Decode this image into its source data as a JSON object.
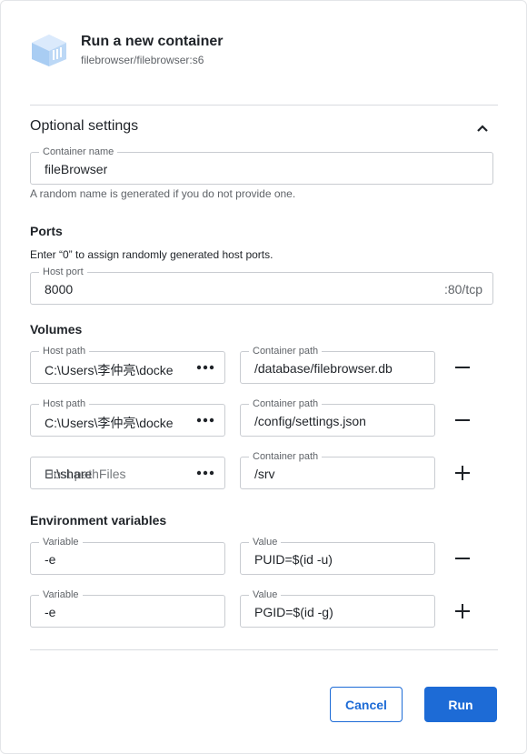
{
  "header": {
    "title": "Run a new container",
    "image": "filebrowser/filebrowser:s6",
    "logo_icon": "container-cube-icon"
  },
  "optional": {
    "title": "Optional settings",
    "toggle_icon": "chevron-up-icon",
    "container_name": {
      "label": "Container name",
      "value": "fileBrowser",
      "helper": "A random name is generated if you do not provide one."
    }
  },
  "ports": {
    "title": "Ports",
    "note": "Enter “0” to assign randomly generated host ports.",
    "host_port": {
      "label": "Host port",
      "value": "8000",
      "suffix": ":80/tcp"
    }
  },
  "volumes": {
    "title": "Volumes",
    "rows": [
      {
        "host_label": "Host path",
        "host_value": "C:\\Users\\李仲亮\\docke",
        "container_label": "Container path",
        "container_value": "/database/filebrowser.db",
        "action": "remove"
      },
      {
        "host_label": "Host path",
        "host_value": "C:\\Users\\李仲亮\\docke",
        "container_label": "Container path",
        "container_value": "/config/settings.json",
        "action": "remove"
      },
      {
        "host_text_a": "E:\\share",
        "host_text_b": "Host pathFiles",
        "container_label": "Container path",
        "container_value": "/srv",
        "action": "add"
      }
    ]
  },
  "env": {
    "title": "Environment variables",
    "rows": [
      {
        "var_label": "Variable",
        "var_value": "-e",
        "val_label": "Value",
        "val_value": "PUID=$(id -u)",
        "action": "remove"
      },
      {
        "var_label": "Variable",
        "var_value": "-e",
        "val_label": "Value",
        "val_value": "PGID=$(id -g)",
        "action": "add"
      }
    ]
  },
  "footer": {
    "cancel_label": "Cancel",
    "run_label": "Run"
  },
  "colors": {
    "accent": "#1d6bd6",
    "logo": "#a9cdf3",
    "border": "#c9ccd1"
  }
}
